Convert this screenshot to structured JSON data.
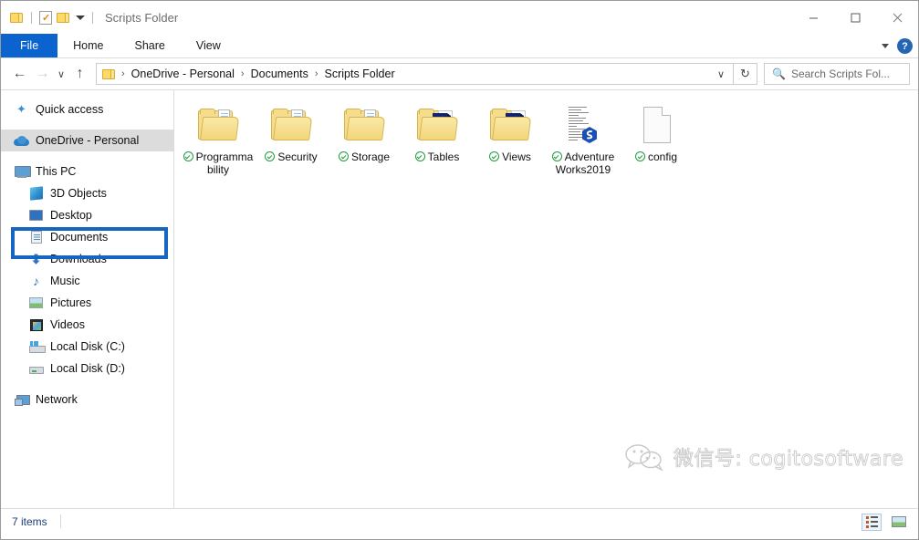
{
  "window": {
    "title": "Scripts Folder",
    "quick_access": [
      "folder-icon",
      "properties-icon",
      "folder-icon",
      "dropdown-caret"
    ],
    "controls": {
      "minimize": "—",
      "maximize": "☐",
      "close": "✕"
    }
  },
  "ribbon": {
    "tabs": [
      {
        "label": "File",
        "active": true
      },
      {
        "label": "Home",
        "active": false
      },
      {
        "label": "Share",
        "active": false
      },
      {
        "label": "View",
        "active": false
      }
    ],
    "help_label": "?"
  },
  "address": {
    "back_arrow": "←",
    "forward_arrow": "→",
    "recent_caret": "∨",
    "up_arrow": "↑",
    "crumbs": [
      "OneDrive - Personal",
      "Documents",
      "Scripts Folder"
    ],
    "separator": "›",
    "dropdown_caret": "∨",
    "refresh_icon": "↻"
  },
  "search": {
    "icon": "search-icon",
    "placeholder": "Search Scripts Fol..."
  },
  "sidebar": {
    "items": [
      {
        "label": "Quick access",
        "icon": "star-icon",
        "indent": 0,
        "selected": false
      },
      {
        "label": "OneDrive - Personal",
        "icon": "cloud-icon",
        "indent": 0,
        "selected": true
      },
      {
        "label": "This PC",
        "icon": "pc-icon",
        "indent": 0,
        "selected": false
      },
      {
        "label": "3D Objects",
        "icon": "3d-objects-icon",
        "indent": 1,
        "selected": false
      },
      {
        "label": "Desktop",
        "icon": "desktop-icon",
        "indent": 1,
        "selected": false
      },
      {
        "label": "Documents",
        "icon": "documents-icon",
        "indent": 1,
        "selected": false
      },
      {
        "label": "Downloads",
        "icon": "downloads-icon",
        "indent": 1,
        "selected": false
      },
      {
        "label": "Music",
        "icon": "music-icon",
        "indent": 1,
        "selected": false
      },
      {
        "label": "Pictures",
        "icon": "pictures-icon",
        "indent": 1,
        "selected": false
      },
      {
        "label": "Videos",
        "icon": "videos-icon",
        "indent": 1,
        "selected": false
      },
      {
        "label": "Local Disk (C:)",
        "icon": "disk-c-icon",
        "indent": 1,
        "selected": false
      },
      {
        "label": "Local Disk (D:)",
        "icon": "disk-d-icon",
        "indent": 1,
        "selected": false
      },
      {
        "label": "Network",
        "icon": "network-icon",
        "indent": 0,
        "selected": false
      }
    ],
    "annotation": {
      "target": "OneDrive - Personal",
      "color": "#1665c1"
    }
  },
  "files": [
    {
      "name": "Programmability",
      "type": "folder",
      "sync": "synced",
      "sync_color": "#1f9c3d"
    },
    {
      "name": "Security",
      "type": "folder",
      "sync": "synced",
      "sync_color": "#1f9c3d"
    },
    {
      "name": "Storage",
      "type": "folder",
      "sync": "synced",
      "sync_color": "#1f9c3d"
    },
    {
      "name": "Tables",
      "type": "folder-ssms",
      "sync": "synced",
      "sync_color": "#1f9c3d"
    },
    {
      "name": "Views",
      "type": "folder-ssms",
      "sync": "synced",
      "sync_color": "#1f9c3d"
    },
    {
      "name": "AdventureWorks2019",
      "type": "sql-script",
      "sync": "synced",
      "sync_color": "#1f9c3d"
    },
    {
      "name": "config",
      "type": "document",
      "sync": "synced",
      "sync_color": "#1f9c3d"
    }
  ],
  "watermark": {
    "text": "微信号: cogitosoftware",
    "icon": "wechat-icon"
  },
  "statusbar": {
    "item_count": "7 items",
    "views": [
      {
        "name": "details-view",
        "active": true
      },
      {
        "name": "large-icons-view",
        "active": false
      }
    ]
  }
}
